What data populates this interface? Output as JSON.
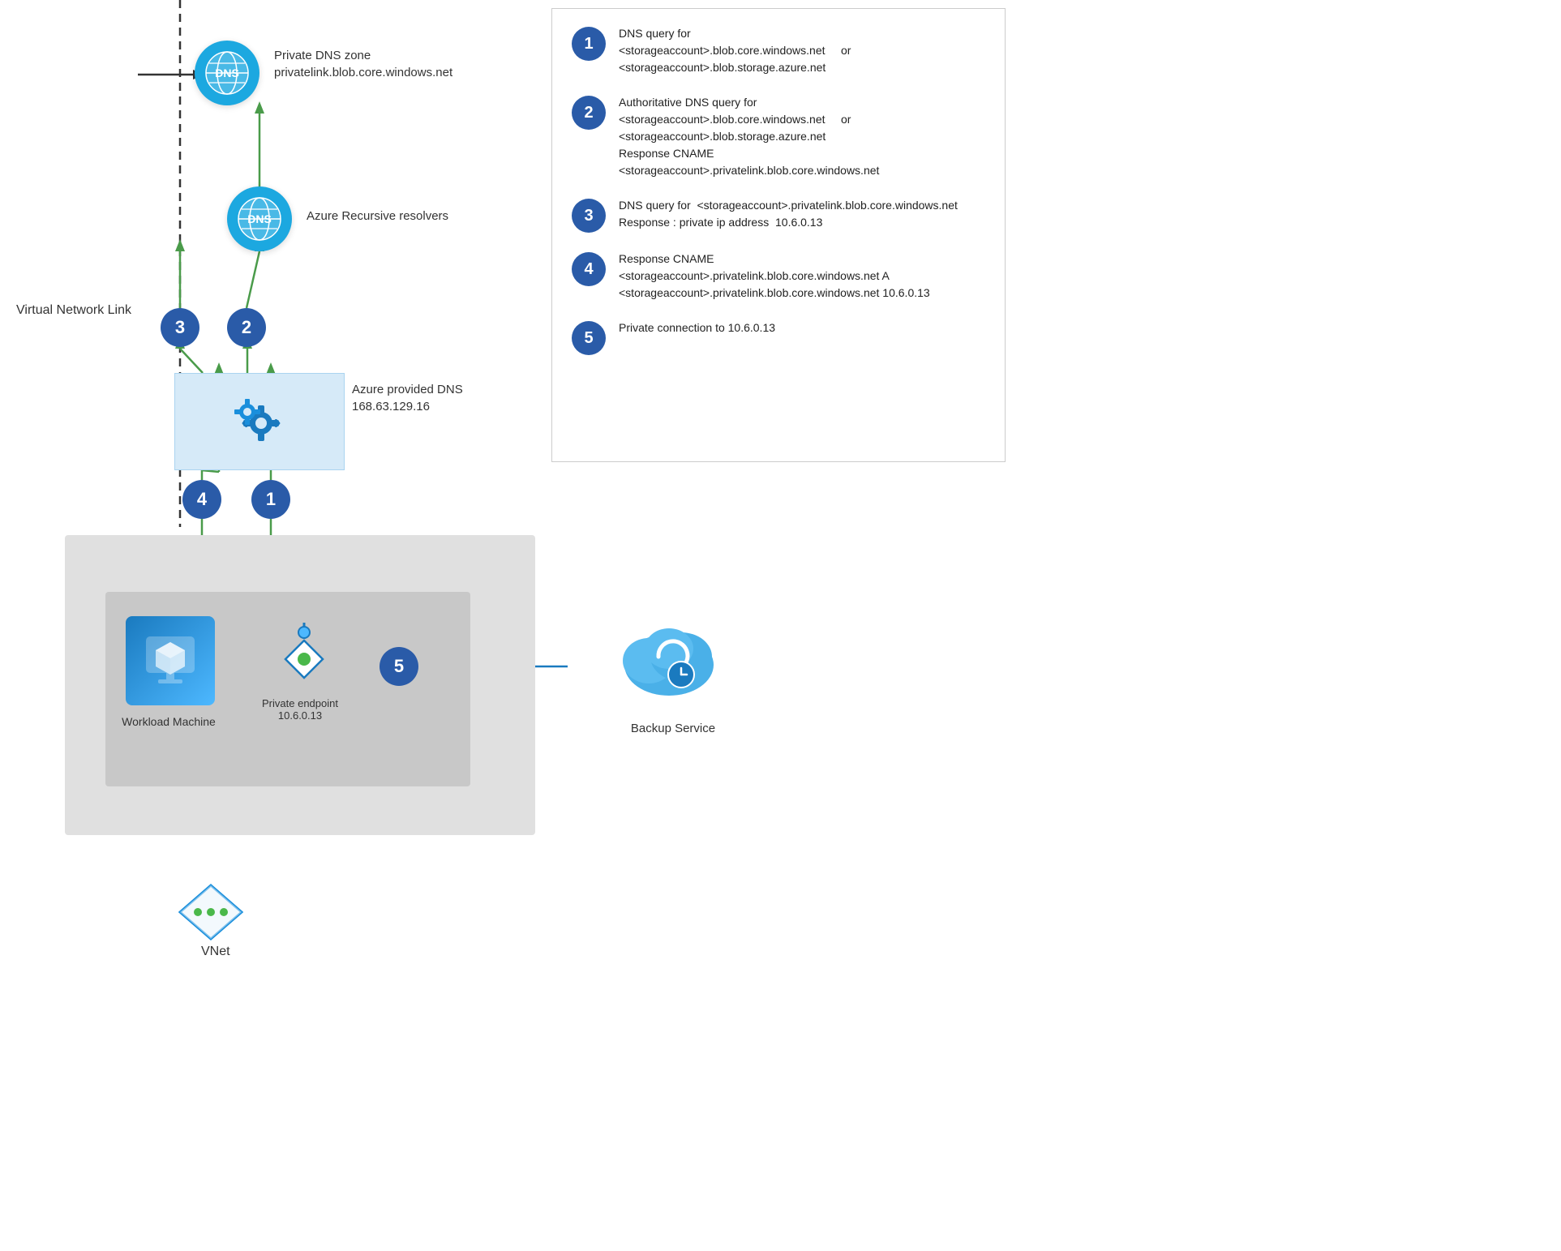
{
  "diagram": {
    "private_dns": {
      "label_line1": "Private DNS zone",
      "label_line2": "privatelink.blob.core.windows.net"
    },
    "azure_recursive": {
      "label": "Azure Recursive resolvers"
    },
    "azure_provided_dns": {
      "label_line1": "Azure provided DNS",
      "label_line2": "168.63.129.16"
    },
    "virtual_network_link": "Virtual Network Link",
    "workload_machine": "Workload Machine",
    "private_endpoint": {
      "label_line1": "Private endpoint",
      "label_line2": "10.6.0.13"
    },
    "backup_service": "Backup Service",
    "vnet": "VNet",
    "circles": [
      "3",
      "2",
      "4",
      "1",
      "5"
    ]
  },
  "info_panel": {
    "items": [
      {
        "number": "1",
        "text": "DNS query for\n<storageaccount>.blob.core.windows.net    or\n<storageaccount>.blob.storage.azure.net"
      },
      {
        "number": "2",
        "text": "Authoritative DNS query for\n<storageaccount>.blob.core.windows.net    or\n<storageaccount>.blob.storage.azure.net\nResponse CNAME\n<storageaccount>.privatelink.blob.core.windows.net"
      },
      {
        "number": "3",
        "text": "DNS query for  <storageaccount>.privatelink.blob.core.windows.net\nResponse : private ip address  10.6.0.13"
      },
      {
        "number": "4",
        "text": "Response CNAME\n<storageaccount>.privatelink.blob.core.windows.net A\n<storageaccount>.privatelink.blob.core.windows.net 10.6.0.13"
      },
      {
        "number": "5",
        "text": "Private connection to 10.6.0.13"
      }
    ]
  }
}
